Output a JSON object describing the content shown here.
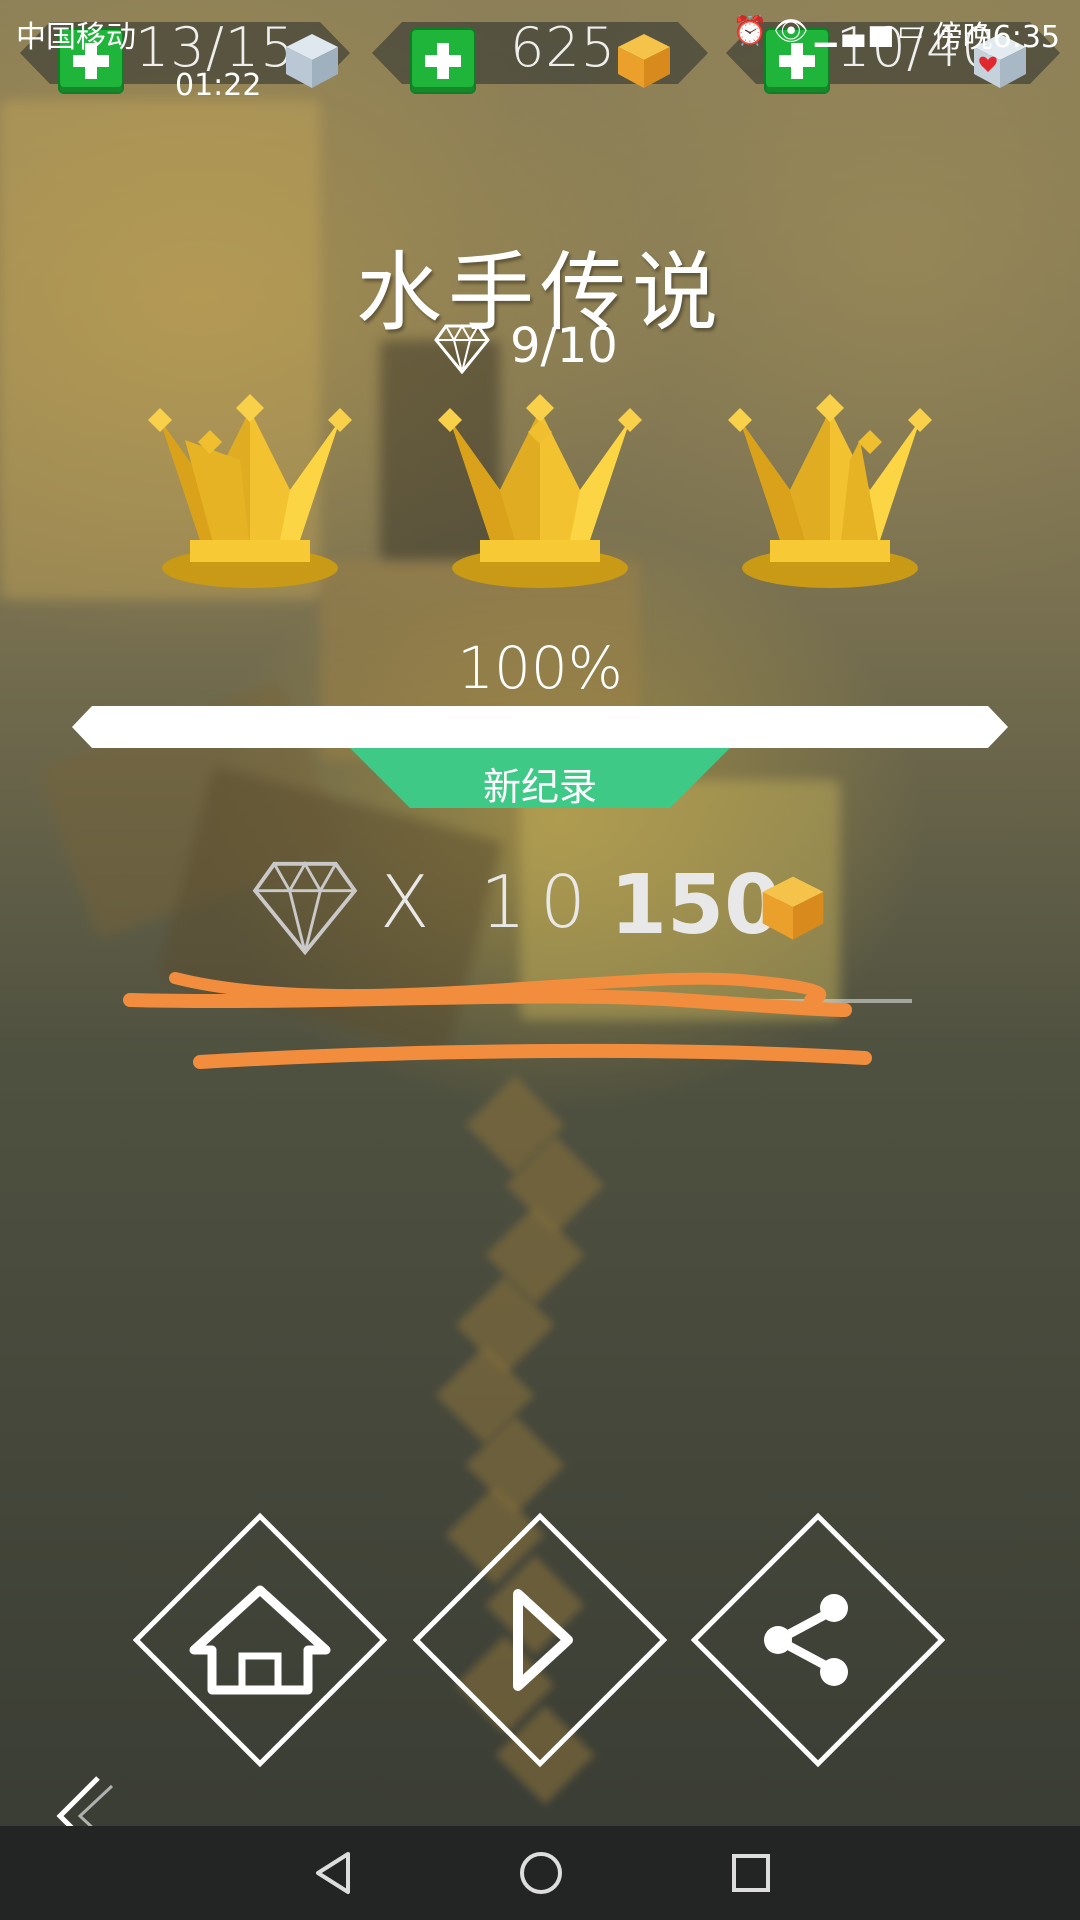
{
  "status_bar": {
    "carrier": "中国移动",
    "time": "傍晚6:35",
    "icons": [
      "alarm-icon",
      "eye-icon",
      "signal-2g-icon",
      "battery-icon"
    ]
  },
  "hud": {
    "left": {
      "value": "13/15",
      "timer": "01:22",
      "icon": "blue-cube-icon"
    },
    "center": {
      "value": "625",
      "icon": "gold-cube-icon"
    },
    "right": {
      "value": "10/40",
      "icon": "heart-cube-icon"
    }
  },
  "level": {
    "title": "水手传说",
    "gems": "9/10",
    "crowns": 3,
    "percent": "100%",
    "progress": 1.0,
    "record_label": "新纪录"
  },
  "reward": {
    "multiplier": "X 10",
    "amount": "150"
  },
  "actions": [
    "home-icon",
    "play-icon",
    "share-icon"
  ],
  "colors": {
    "accent_green": "#3ec986",
    "plus_green": "#1eb53a",
    "gold": "#f2c230",
    "scribble": "#f28d3e"
  }
}
